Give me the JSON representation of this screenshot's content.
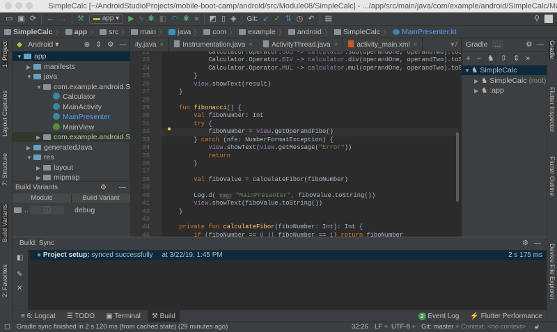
{
  "window": {
    "title": "SimpleCalc [~/AndroidStudioProjects/mobile-boot-camp/android/src/Module08/SimpleCalc] - .../app/src/main/java/com/example/android/SimpleCalc/MainPr..."
  },
  "toolbar": {
    "run_config": "app",
    "git_label": "Git:"
  },
  "breadcrumb": [
    "SimpleCalc",
    "app",
    "src",
    "main",
    "java",
    "com",
    "example",
    "android",
    "SimpleCalc",
    "MainPresenter.kt"
  ],
  "left_stripe": {
    "project": "1: Project",
    "layout_captures": "Layout Captures",
    "structure": "7: Structure",
    "build_variants": "Build Variants",
    "favorites": "2: Favorites"
  },
  "project": {
    "view_mode": "Android",
    "tree": [
      {
        "label": "app",
        "arrow": "▼",
        "icon": "folder"
      },
      {
        "label": "manifests",
        "arrow": "▶",
        "icon": "folder"
      },
      {
        "label": "java",
        "arrow": "▼",
        "icon": "folder"
      },
      {
        "label": "com.example.android.SimpleCalc",
        "arrow": "▼",
        "icon": "package"
      },
      {
        "label": "Calculator",
        "arrow": "",
        "icon": "class"
      },
      {
        "label": "MainActivity",
        "arrow": "",
        "icon": "class"
      },
      {
        "label": "MainPresenter",
        "arrow": "",
        "icon": "class"
      },
      {
        "label": "MainView",
        "arrow": "",
        "icon": "interface"
      },
      {
        "label": "com.example.android.SimpleCalc",
        "arrow": "▶",
        "icon": "package"
      },
      {
        "label": "generatedJava",
        "arrow": "▶",
        "icon": "folder"
      },
      {
        "label": "res",
        "arrow": "▼",
        "icon": "folder"
      },
      {
        "label": "layout",
        "arrow": "▶",
        "icon": "package"
      },
      {
        "label": "mipmap",
        "arrow": "▶",
        "icon": "package"
      }
    ]
  },
  "build_variants": {
    "title": "Build Variants",
    "col_module": "Module",
    "col_variant": "Build Variant",
    "module": "..",
    "variant": "debug"
  },
  "editor": {
    "tabs": [
      "ity.java",
      "Instrumentation.java",
      "ActivityThread.java",
      "activity_main.xml"
    ],
    "overflow": "▾7",
    "first_line": 22,
    "lines": [
      [
        [
          "t",
          "            Calculator.Operator."
        ],
        [
          "p",
          "SUB"
        ],
        [
          "t",
          " -> "
        ],
        [
          "p",
          "calculator"
        ],
        [
          "t",
          ".sub(operandOne, operandTwo).toS"
        ]
      ],
      [
        [
          "t",
          "            Calculator.Operator."
        ],
        [
          "p",
          "DIV"
        ],
        [
          "t",
          " -> "
        ],
        [
          "p",
          "calculator"
        ],
        [
          "t",
          ".div(operandOne, operandTwo).toS"
        ]
      ],
      [
        [
          "t",
          "            Calculator.Operator."
        ],
        [
          "p",
          "MUL"
        ],
        [
          "t",
          " -> "
        ],
        [
          "p",
          "calculator"
        ],
        [
          "t",
          ".mul(operandOne, operandTwo).toS"
        ]
      ],
      [
        [
          "t",
          "        }"
        ]
      ],
      [
        [
          "t",
          "        "
        ],
        [
          "p",
          "view"
        ],
        [
          "t",
          ".showText(result)"
        ]
      ],
      [
        [
          "t",
          "    }"
        ]
      ],
      [],
      [
        [
          "t",
          "    "
        ],
        [
          "k",
          "fun "
        ],
        [
          "f",
          "fibonacci"
        ],
        [
          "t",
          "() {"
        ]
      ],
      [
        [
          "t",
          "        "
        ],
        [
          "k",
          "val "
        ],
        [
          "t",
          "fiboNumber: Int"
        ]
      ],
      [
        [
          "t",
          "        "
        ],
        [
          "k",
          "try "
        ],
        [
          "t",
          "{"
        ]
      ],
      [
        [
          "t",
          "            fiboNumber = "
        ],
        [
          "p",
          "view"
        ],
        [
          "t",
          ".getOperandFibo()"
        ]
      ],
      [
        [
          "t",
          "        } "
        ],
        [
          "k",
          "catch "
        ],
        [
          "t",
          "(nfe: NumberFormatException) {"
        ]
      ],
      [
        [
          "t",
          "            "
        ],
        [
          "p",
          "view"
        ],
        [
          "t",
          ".showText("
        ],
        [
          "p",
          "view"
        ],
        [
          "t",
          ".getMessage("
        ],
        [
          "s",
          "\"Error\""
        ],
        [
          "t",
          "))"
        ]
      ],
      [
        [
          "t",
          "            "
        ],
        [
          "k",
          "return"
        ]
      ],
      [
        [
          "t",
          "        }"
        ]
      ],
      [],
      [
        [
          "t",
          "        "
        ],
        [
          "k",
          "val "
        ],
        [
          "t",
          "fiboValue = calculateFibor(fiboNumber)"
        ]
      ],
      [],
      [
        [
          "t",
          "        Log.d( "
        ],
        [
          "h",
          "tag:"
        ],
        [
          "t",
          " "
        ],
        [
          "s",
          "\"MainPresenter\""
        ],
        [
          "k",
          ", "
        ],
        [
          "t",
          "fiboValue.toString())"
        ]
      ],
      [
        [
          "t",
          "        "
        ],
        [
          "p",
          "view"
        ],
        [
          "t",
          ".showText(fiboValue.toString())"
        ]
      ],
      [
        [
          "t",
          "    }"
        ]
      ],
      [],
      [
        [
          "t",
          "    "
        ],
        [
          "k",
          "private fun "
        ],
        [
          "f",
          "calculateFibor"
        ],
        [
          "t",
          "(fiboNumber: Int): Int {"
        ]
      ],
      [
        [
          "t",
          "        "
        ],
        [
          "k",
          "if "
        ],
        [
          "t",
          "(fiboNumber == "
        ],
        [
          "p",
          "0"
        ],
        [
          "t",
          " || fiboNumber == "
        ],
        [
          "p",
          "1"
        ],
        [
          "t",
          ") "
        ],
        [
          "k",
          "return "
        ],
        [
          "t",
          "fiboNumber"
        ]
      ]
    ]
  },
  "gradle": {
    "title": "Gradle",
    "more": "...",
    "tree": [
      {
        "label": "SimpleCalc",
        "arrow": "▼",
        "suffix": ""
      },
      {
        "label": "SimpleCalc",
        "arrow": "▶",
        "suffix": " (root)"
      },
      {
        "label": ":app",
        "arrow": "▶",
        "suffix": ""
      }
    ]
  },
  "right_stripe": {
    "gradle": "Gradle",
    "flutter_inspector": "Flutter Inspector",
    "flutter_outline": "Flutter Outline",
    "device_explorer": "Device File Explorer"
  },
  "build": {
    "title": "Build: Sync",
    "row_bold": "Project setup:",
    "row_text": " synced successfully",
    "row_time": "at 3/22/19, 1:45 PM",
    "row_duration": "2 s 175 ms"
  },
  "tool_windows": {
    "logcat": "6: Logcat",
    "todo": "TODO",
    "terminal": "Terminal",
    "build": "Build",
    "event_count": "2",
    "event_log": "Event Log",
    "flutter_perf": "Flutter Performance"
  },
  "status": {
    "message": "Gradle sync finished in 2 s 120 ms (from cached state) (29 minutes ago)",
    "position": "32:26",
    "line_sep": "LF ÷",
    "encoding": "UTF-8 ÷",
    "git": "Git: master ÷",
    "context": "Context: <no context>"
  },
  "colors": {
    "accent": "#0d293e",
    "keyword": "#cc7832",
    "function": "#ffc66d",
    "string": "#6a8759",
    "field": "#9876aa"
  }
}
